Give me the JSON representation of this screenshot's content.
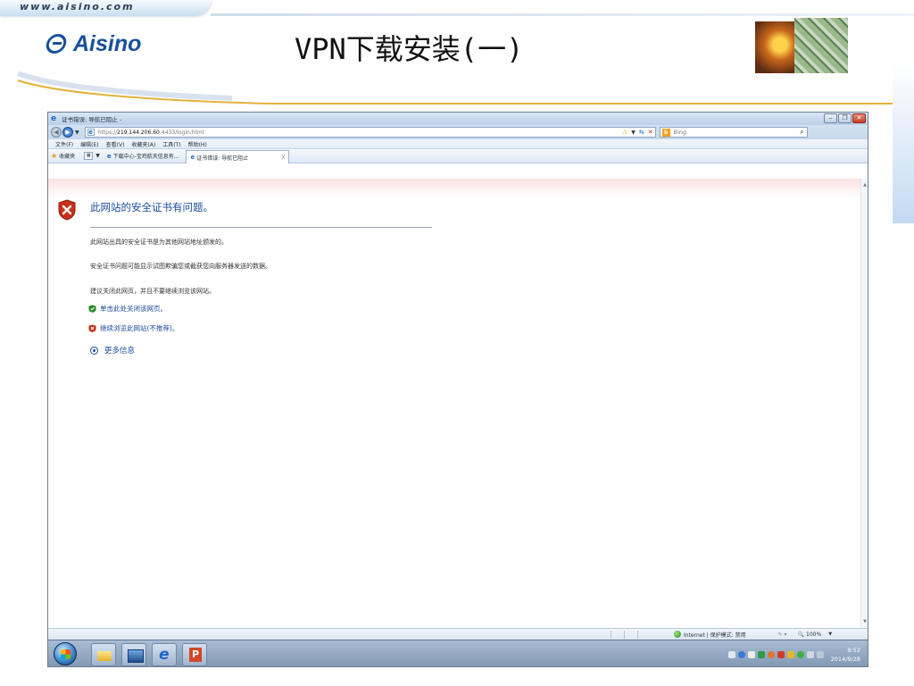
{
  "slide": {
    "url": "www.aisino.com",
    "logo_text": "Aisino",
    "title": "VPN下载安装(一)"
  },
  "browser": {
    "window_title": "证书错误: 导航已阻止 -",
    "address": {
      "scheme": "https://",
      "host": "219.144.206.60",
      "port_path": ":4433/login.html"
    },
    "search_placeholder": "Bing",
    "menu": [
      "文件(F)",
      "编辑(E)",
      "查看(V)",
      "收藏夹(A)",
      "工具(T)",
      "帮助(H)"
    ],
    "favorites_label": "收藏夹",
    "tabs": [
      {
        "label": "下载中心-宝鸡航天信息有..."
      },
      {
        "label": "证书错误: 导航已阻止",
        "close": "X"
      }
    ],
    "window_controls": {
      "minimize": "–",
      "restore": "❐",
      "close": "✕"
    }
  },
  "error_page": {
    "heading": "此网站的安全证书有问题。",
    "paragraphs": [
      "此网站出具的安全证书是为其他网站地址颁发的。",
      "安全证书问题可能显示试图欺骗您或截获您向服务器发送的数据。",
      "建议关闭此网页，并且不要继续浏览该网站。"
    ],
    "close_link": "单击此处关闭该网页。",
    "continue_link": "继续浏览此网站(不推荐)。",
    "more_info": "更多信息"
  },
  "status_bar": {
    "zone": "Internet | 保护模式: 禁用",
    "zoom": "100%"
  },
  "taskbar": {
    "time": "9:52",
    "date": "2014/9/28"
  },
  "colors": {
    "link_blue": "#1c4da0",
    "error_red": "#c7301a",
    "safe_green": "#2a8a2a"
  }
}
